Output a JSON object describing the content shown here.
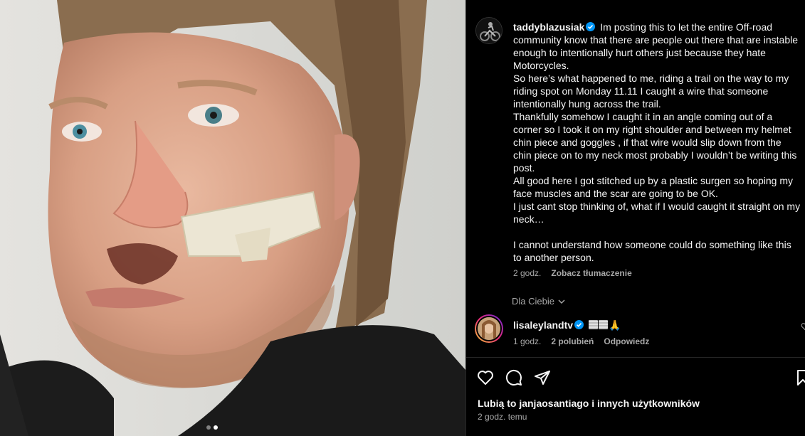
{
  "post": {
    "username": "taddyblazusiak",
    "caption_lines": [
      "Im posting this to let the entire Off-road community know that there are people out there that are instable enough to intentionally hurt others just because they hate Motorcycles.",
      "So here’s what happened to me, riding a trail on the way to my riding spot on Monday 11.11 I caught a wire that someone intentionally hung across the trail.",
      "Thankfully somehow I caught it in an angle coming out of a corner so I took it on my right shoulder and between my helmet chin piece and goggles , if that wire would slip down from the chin piece on to my neck most probably I wouldn’t be writing this post.",
      "All good here I got stitched up by a plastic surgen so hoping my face muscles and the scar are going to be OK.",
      "I just cant stop thinking of, what if I would caught it straight on my neck…",
      "",
      "I cannot understand how someone could do something like this to another person."
    ],
    "time": "2 godz.",
    "translate_label": "Zobacz tłumaczenie"
  },
  "for_you_label": "Dla Ciebie",
  "comment": {
    "username": "lisaleylandtv",
    "emoji_suffix": "🙏",
    "time": "1 godz.",
    "likes": "2 polubień",
    "reply_label": "Odpowiedz"
  },
  "likes_text": "Lubią to janjaosantiago i innych użytkowników",
  "post_time": "2 godz. temu",
  "carousel": {
    "count": 2,
    "active_index": 1
  },
  "icons": {
    "verified": "verified-badge-icon",
    "like": "heart-icon",
    "comment": "comment-icon",
    "share": "share-icon",
    "save": "bookmark-icon",
    "chevron": "chevron-down-icon"
  },
  "colors": {
    "verified": "#0095f6",
    "background": "#000000",
    "secondary_text": "#a8a8a8"
  }
}
